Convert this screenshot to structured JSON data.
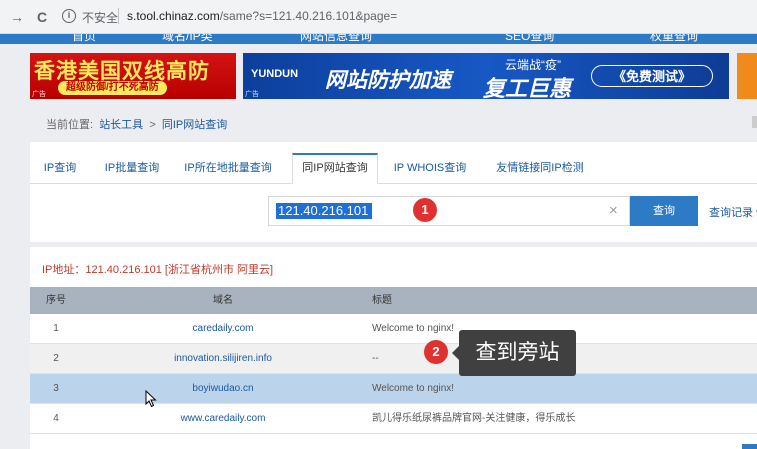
{
  "browser": {
    "back_glyph": "→",
    "reload_glyph": "C",
    "info_glyph": "i",
    "security_label": "不安全",
    "url_host": "s.tool.chinaz.com",
    "url_rest": "/same?s=121.40.216.101&page="
  },
  "site_nav": [
    "首页",
    "域名/IP类",
    "网站信息查询",
    "SEO查询",
    "权重查询"
  ],
  "banners": {
    "left_title": "香港美国双线高防",
    "left_sub": "超级防御/打不死高防",
    "ad_label": "广告",
    "yundun_logo": "YUNDUN",
    "yundun_slogan": "网站防护加速",
    "yundun_sub1": "云端战“疫”",
    "yundun_sub2": "复工巨惠",
    "yundun_button": "《免费测试》"
  },
  "breadcrumb": {
    "label": "当前位置:",
    "items": [
      "站长工具",
      "同IP网站查询"
    ],
    "sep": ">"
  },
  "tabs": [
    "IP查询",
    "IP批量查询",
    "IP所在地批量查询",
    "同IP网站查询",
    "IP WHOIS查询",
    "友情链接同IP检测"
  ],
  "search": {
    "value": "121.40.216.101",
    "clear_glyph": "×",
    "button": "查询",
    "history": "查询记录 ▾"
  },
  "result": {
    "ip_line": "IP地址：121.40.216.101 [浙江省杭州市 阿里云]",
    "headers": [
      "序号",
      "域名",
      "标题"
    ],
    "rows": [
      {
        "num": "1",
        "domain": "caredaily.com",
        "title": "Welcome to nginx!"
      },
      {
        "num": "2",
        "domain": "innovation.silijiren.info",
        "title": "--"
      },
      {
        "num": "3",
        "domain": "boyiwudao.cn",
        "title": "Welcome to nginx!"
      },
      {
        "num": "4",
        "domain": "www.caredaily.com",
        "title": "凯儿得乐纸尿裤品牌官网-关注健康，得乐成长"
      }
    ]
  },
  "annotations": {
    "badge1": "1",
    "badge2": "2",
    "tooltip": "查到旁站"
  },
  "colors": {
    "accent": "#2d7bc6",
    "link": "#1a5aa0",
    "badge": "#e03131",
    "selected_row": "#bcd3ec",
    "alt_row": "#f0f0f0"
  }
}
